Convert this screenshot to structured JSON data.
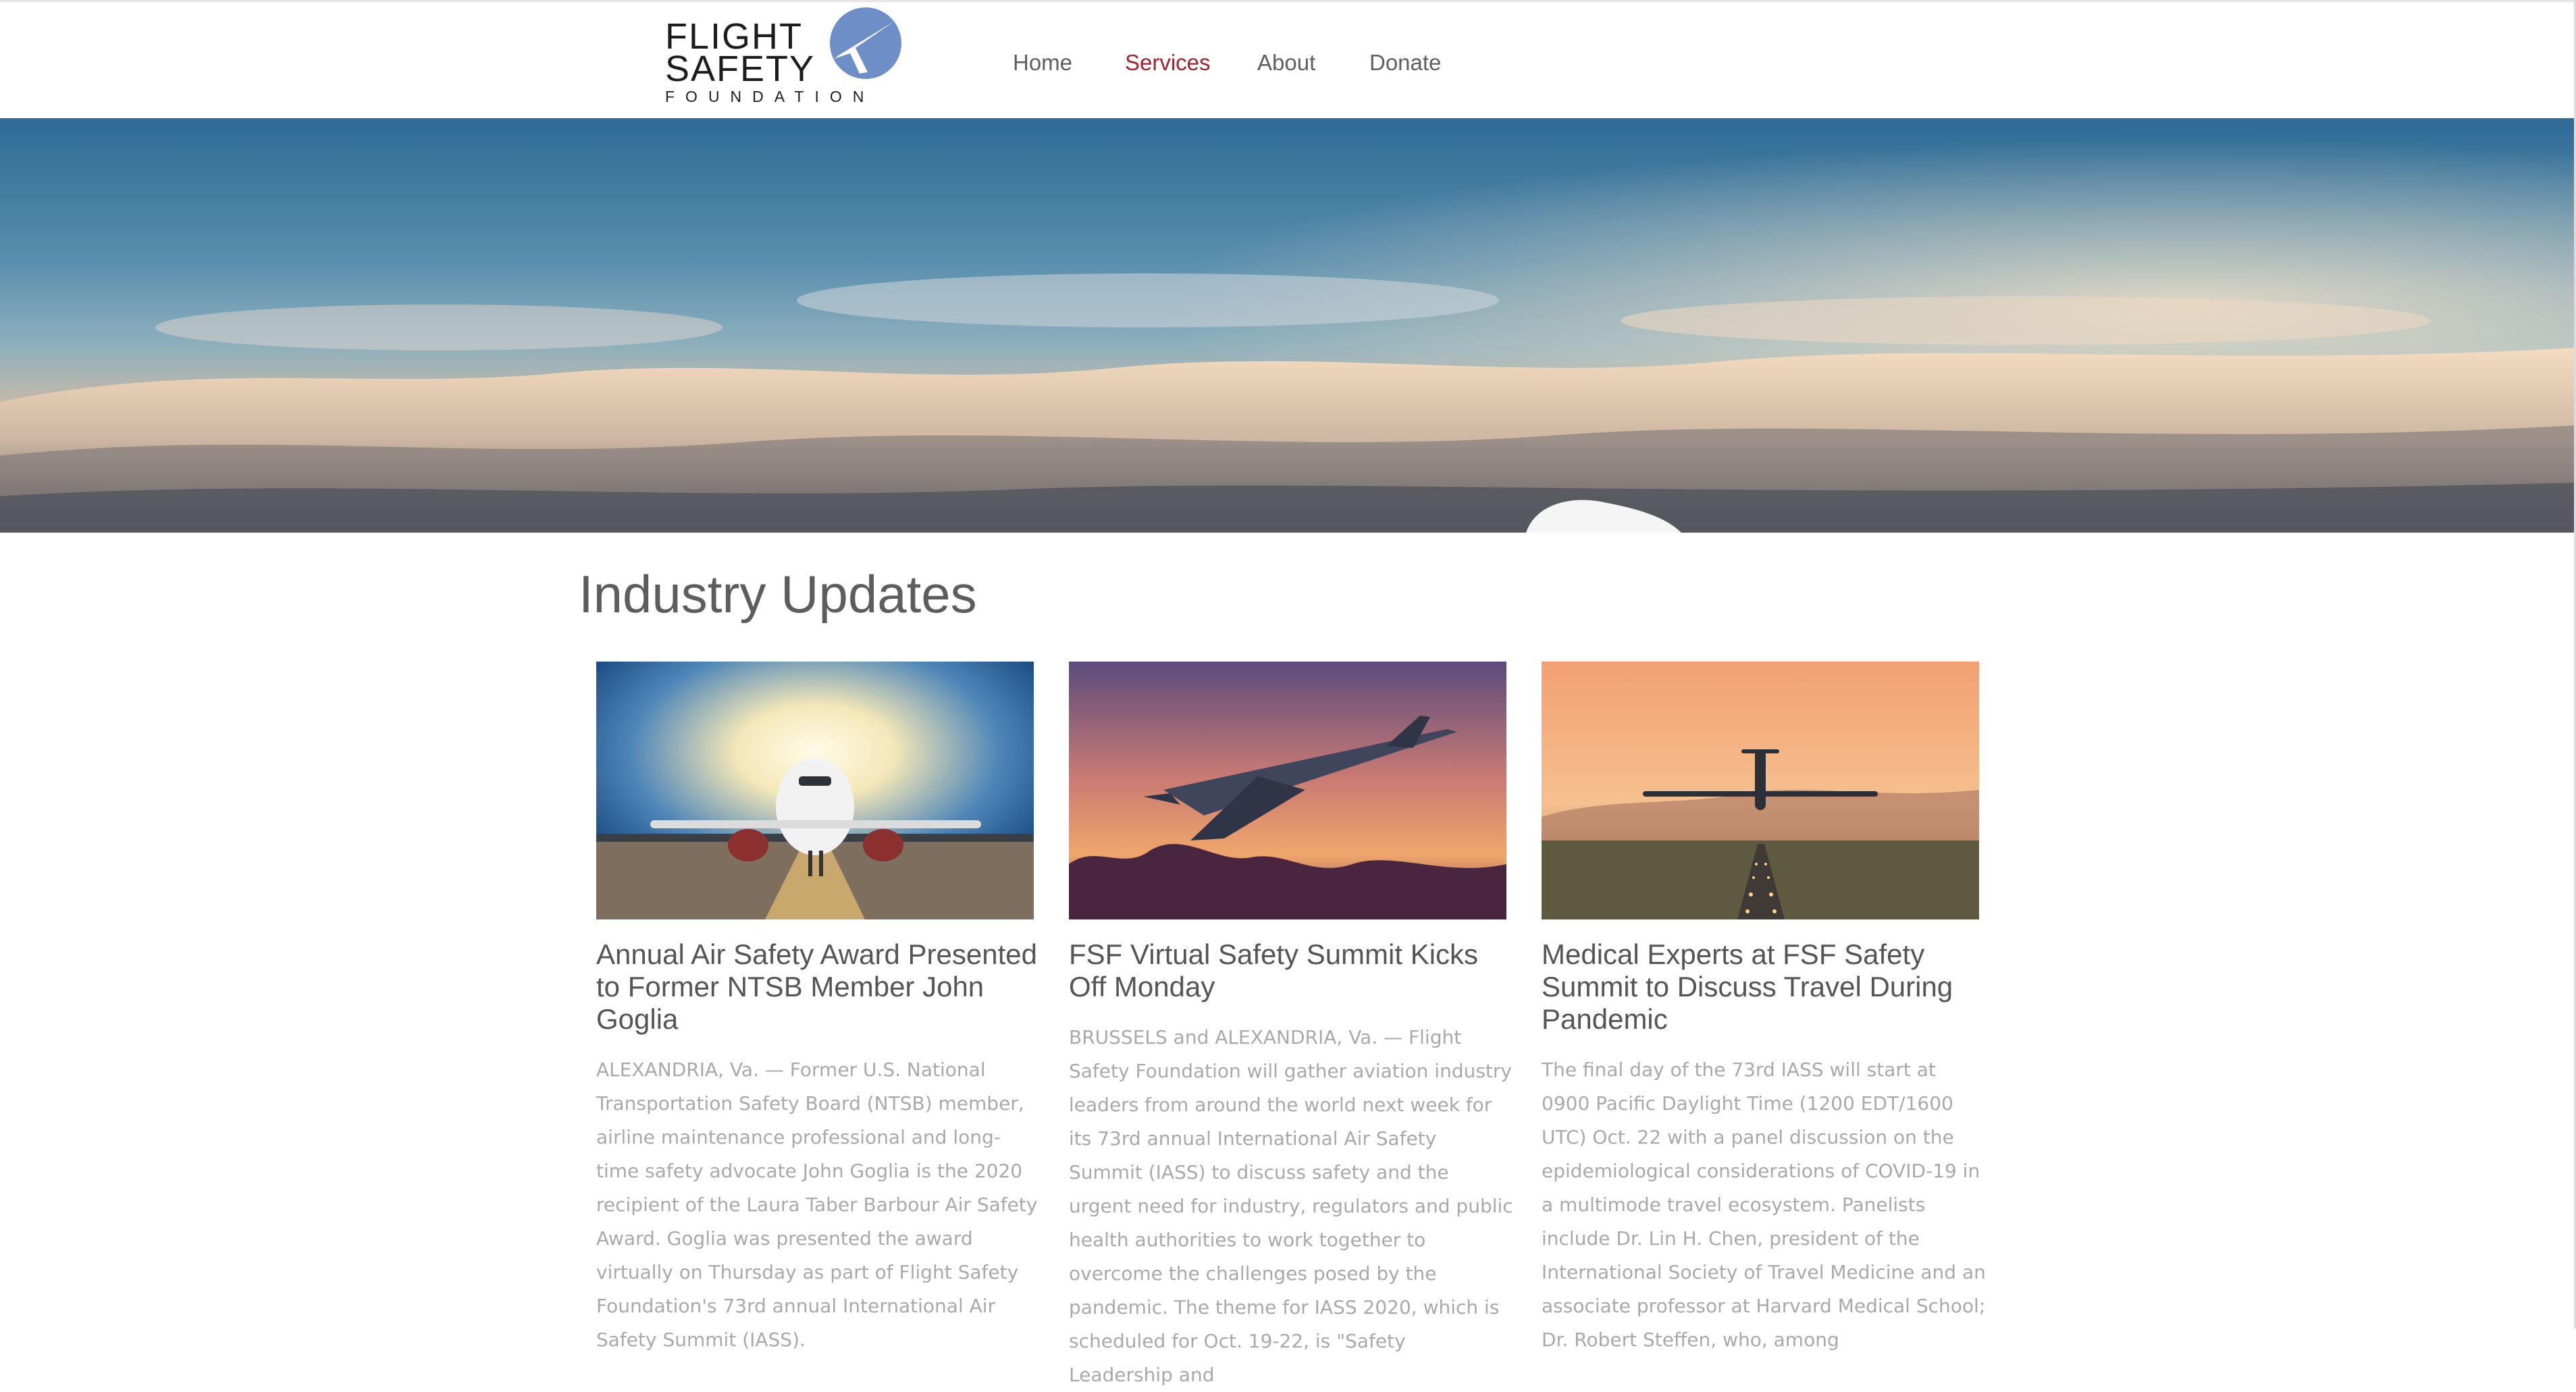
{
  "header": {
    "logo": {
      "line1": "FLIGHT",
      "line2": "SAFETY",
      "line3": "FOUNDATION"
    },
    "nav": [
      {
        "label": "Home",
        "active": false
      },
      {
        "label": "Services",
        "active": true
      },
      {
        "label": "About",
        "active": false
      },
      {
        "label": "Donate",
        "active": false
      }
    ],
    "accent_color": "#a3222d"
  },
  "main": {
    "section_title": "Industry Updates",
    "cards": [
      {
        "image": "airliner-on-runway-image",
        "title": "Annual Air Safety Award Presented to Former NTSB Member John Goglia",
        "body": "ALEXANDRIA, Va. — Former U.S. National Transportation Safety Board (NTSB) member, airline maintenance professional and long-time safety advocate John Goglia is the 2020 recipient of the Laura Taber Barbour Air Safety Award. Goglia was presented the award virtually on Thursday as part of Flight Safety Foundation's 73rd annual International Air Safety Summit (IASS)."
      },
      {
        "image": "supersonic-jet-sunset-image",
        "title": "FSF Virtual Safety Summit Kicks Off Monday",
        "body": "BRUSSELS and ALEXANDRIA, Va. — Flight Safety Foundation will gather aviation industry leaders from around the world next week for its 73rd annual International Air Safety Summit (IASS) to discuss safety and the urgent need for industry, regulators and public health authorities to work together to overcome the challenges posed by the pandemic. The theme for IASS 2020, which is scheduled for Oct. 19-22, is \"Safety Leadership and"
      },
      {
        "image": "airliner-landing-approach-image",
        "title": "Medical Experts at FSF Safety Summit to Discuss Travel During Pandemic",
        "body": "The final day of the 73rd IASS will start at 0900 Pacific Daylight Time (1200 EDT/1600 UTC) Oct. 22 with a panel discussion on the epidemiological considerations of COVID-19 in a multimode travel ecosystem. Panelists include Dr. Lin H. Chen, president of the International Society of Travel Medicine and an associate professor at Harvard Medical School; Dr. Robert Steffen, who, among"
      }
    ]
  }
}
